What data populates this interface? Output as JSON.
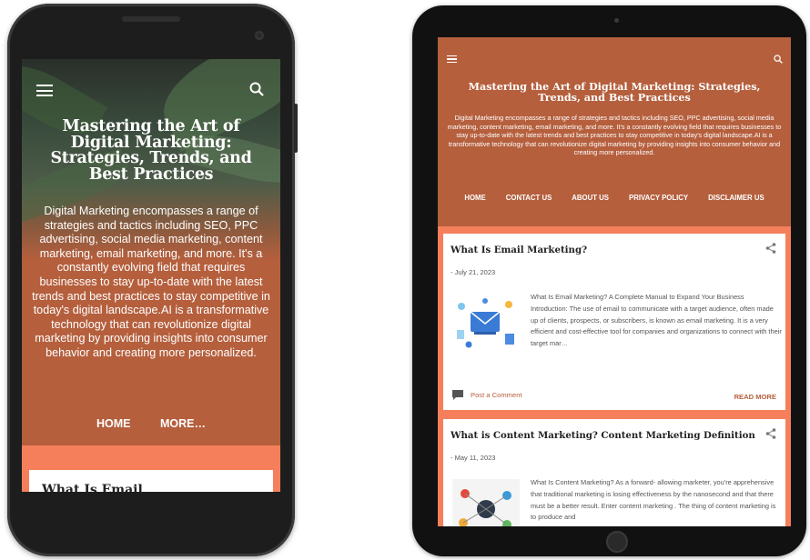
{
  "site": {
    "title": "Mastering the Art of Digital Marketing: Strategies, Trends, and Best Practices",
    "description": "Digital Marketing encompasses a range of strategies and tactics including SEO, PPC advertising, social media marketing, content marketing, email marketing, and more. It's a constantly evolving field that requires businesses to stay up-to-date with the latest trends and best practices to stay competitive in today's digital landscape.AI is a transformative technology that can revolutionize digital marketing by providing insights into consumer behavior and creating more personalized."
  },
  "phone": {
    "nav": [
      "HOME",
      "MORE…"
    ],
    "post_title_partial": "What Is Email"
  },
  "tablet": {
    "nav": [
      "HOME",
      "CONTACT US",
      "ABOUT US",
      "PRIVACY POLICY",
      "DISCLAIMER US"
    ],
    "posts": [
      {
        "title": "What Is Email Marketing?",
        "date": "- July 21, 2023",
        "excerpt": "What Is Email Marketing?  A Complete Manual to Expand Your Business Introduction: The use of email to communicate with a target audience, often made up of clients, prospects, or subscribers, is known as email marketing. It is a very efficient and cost-effective tool for companies and organizations to connect with their target mar…",
        "comment_label": "Post a Comment",
        "read_more": "READ MORE"
      },
      {
        "title": "What is Content Marketing? Content Marketing Definition",
        "date": "- May 11, 2023",
        "excerpt": "What Is Content Marketing? As a forward- allowing marketer, you're apprehensive that traditional marketing is losing effectiveness by the nanosecond and that there must be a better  result.  Enter content marketing .  The  thing of content marketing is to  produce and"
      }
    ]
  },
  "colors": {
    "header_bg": "#b55f3d",
    "page_bg": "#f47f5a",
    "card_bg": "#ffffff",
    "text_white": "#ffffff",
    "link": "#b55f3d"
  },
  "icons": [
    "menu-icon",
    "search-icon",
    "share-icon",
    "comment-icon"
  ]
}
